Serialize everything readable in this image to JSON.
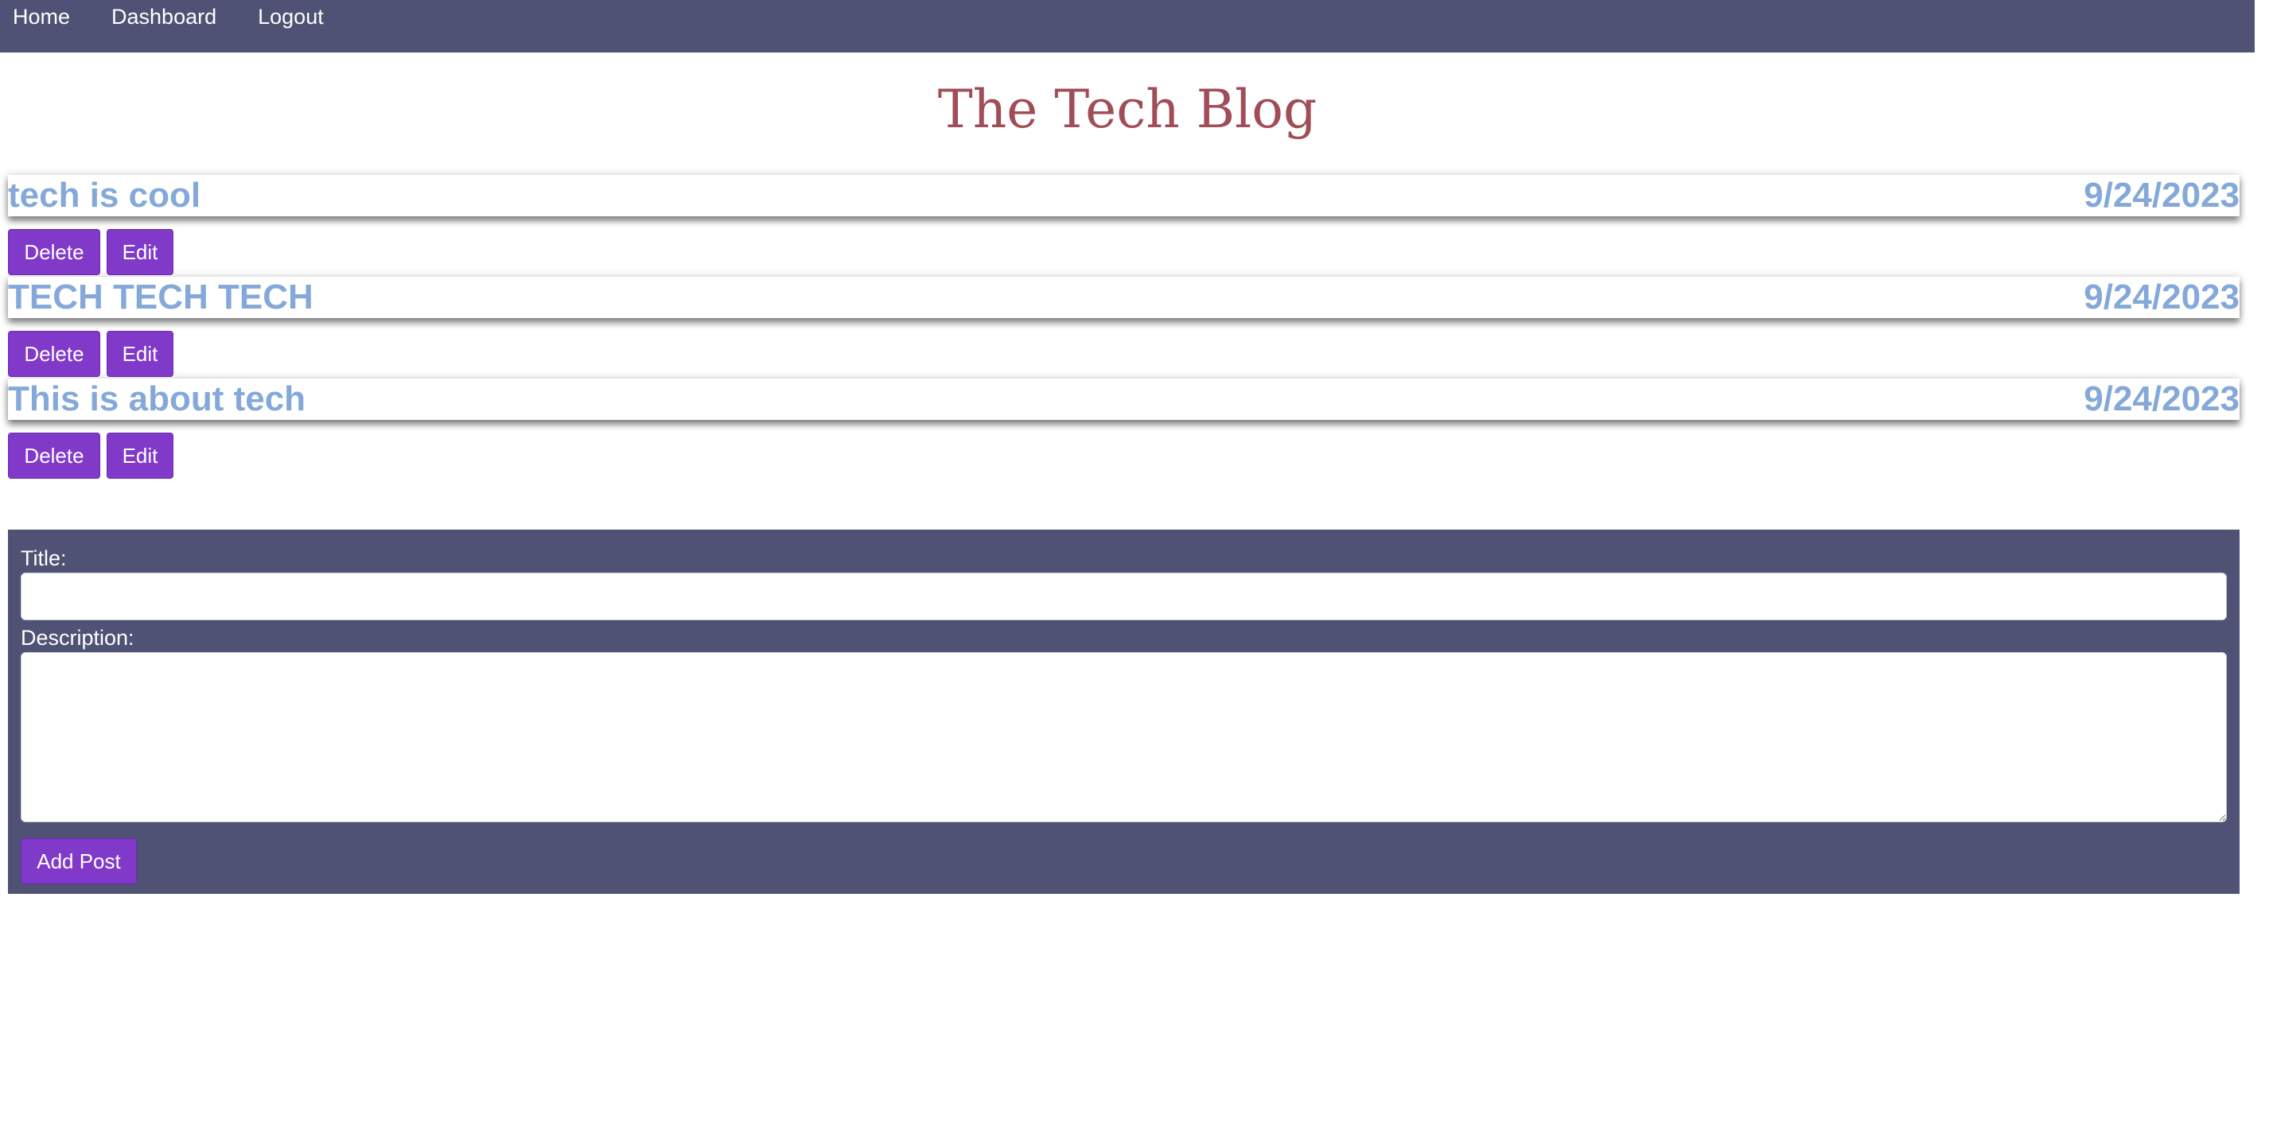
{
  "nav": {
    "items": [
      {
        "label": "Home"
      },
      {
        "label": "Dashboard"
      },
      {
        "label": "Logout"
      }
    ]
  },
  "site": {
    "title": "The Tech Blog"
  },
  "posts": [
    {
      "title": "tech is cool",
      "date": "9/24/2023",
      "delete_label": "Delete",
      "edit_label": "Edit"
    },
    {
      "title": "TECH TECH TECH",
      "date": "9/24/2023",
      "delete_label": "Delete",
      "edit_label": "Edit"
    },
    {
      "title": "This is about tech",
      "date": "9/24/2023",
      "delete_label": "Delete",
      "edit_label": "Edit"
    }
  ],
  "new_post_form": {
    "title_label": "Title:",
    "title_value": "",
    "description_label": "Description:",
    "description_value": "",
    "submit_label": "Add Post"
  },
  "colors": {
    "nav_background": "#4f5274",
    "site_title": "#a04d57",
    "post_text": "#84a9d9",
    "button_background": "#8139c9",
    "form_background": "#4f5274"
  }
}
